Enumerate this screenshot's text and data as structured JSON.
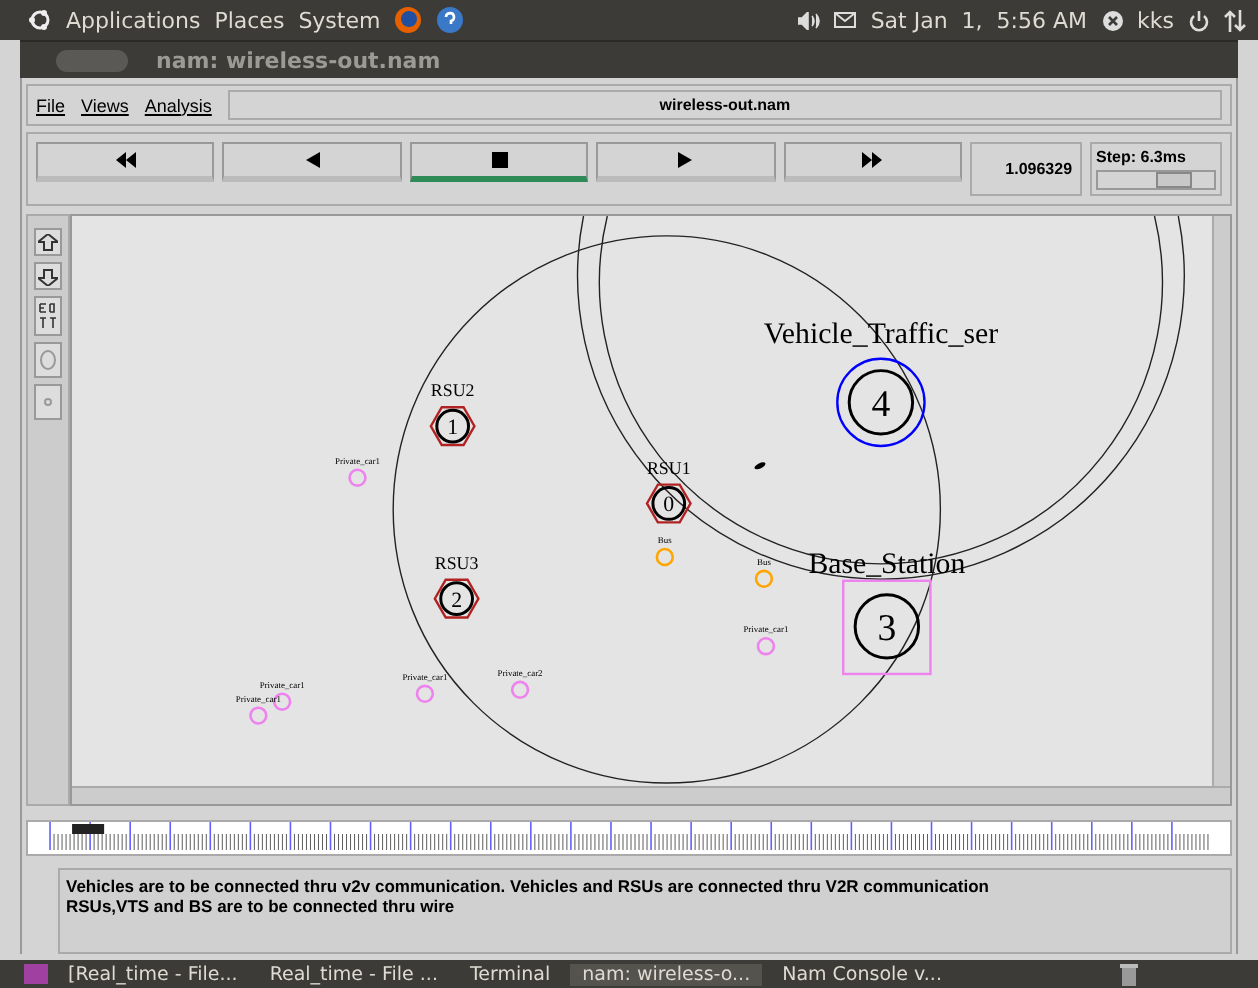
{
  "top_panel": {
    "menus": [
      "Applications",
      "Places",
      "System"
    ],
    "clock": "Sat Jan  1,  5:56 AM",
    "user": "kks"
  },
  "window": {
    "title": "nam: wireless-out.nam"
  },
  "menubar": {
    "items": [
      "File",
      "Views",
      "Analysis"
    ],
    "file_name": "wireless-out.nam"
  },
  "playback": {
    "buttons": [
      {
        "kind": "rewind",
        "selected": false
      },
      {
        "kind": "back",
        "selected": false
      },
      {
        "kind": "stop",
        "selected": true
      },
      {
        "kind": "play",
        "selected": false
      },
      {
        "kind": "forward",
        "selected": false
      }
    ],
    "time": "1.096329",
    "step": "Step: 6.3ms",
    "level": 0.65
  },
  "nodes": [
    {
      "kind": "rsu",
      "label": "RSU2",
      "number": "1"
    },
    {
      "kind": "rsu",
      "label": "RSU3",
      "number": "2"
    },
    {
      "kind": "rsu",
      "label": "RSU1",
      "number": "0"
    },
    {
      "kind": "server",
      "label": "Vehicle_Traffic_ser",
      "number": "4"
    },
    {
      "kind": "station",
      "label": "Base_Station",
      "number": "3"
    },
    {
      "kind": "vehicle",
      "label": "Private_car1",
      "color": "#ee82ee"
    },
    {
      "kind": "vehicle",
      "label": "Private_car1",
      "color": "#ee82ee"
    },
    {
      "kind": "vehicle",
      "label": "Private_car1",
      "color": "#ee82ee"
    },
    {
      "kind": "vehicle",
      "label": "Private_car1",
      "color": "#ee82ee"
    },
    {
      "kind": "vehicle",
      "label": "Private_car2",
      "color": "#ee82ee"
    },
    {
      "kind": "vehicle",
      "label": "Private_car1",
      "color": "#ee82ee"
    },
    {
      "kind": "vehicle",
      "label": "Bus",
      "color": "#ffa500"
    },
    {
      "kind": "vehicle",
      "label": "Bus",
      "color": "#ffa500"
    }
  ],
  "annotations": [
    "Vehicles are to be connected thru v2v communication. Vehicles and RSUs are connected thru V2R communication",
    "RSUs,VTS and BS are to be connected thru wire"
  ],
  "taskbar": [
    {
      "label": "[Real_time - File...",
      "selected": false
    },
    {
      "label": "Real_time - File ...",
      "selected": false
    },
    {
      "label": "Terminal",
      "selected": false
    },
    {
      "label": "nam: wireless-o...",
      "selected": true
    },
    {
      "label": "Nam Console v...",
      "selected": false
    }
  ]
}
